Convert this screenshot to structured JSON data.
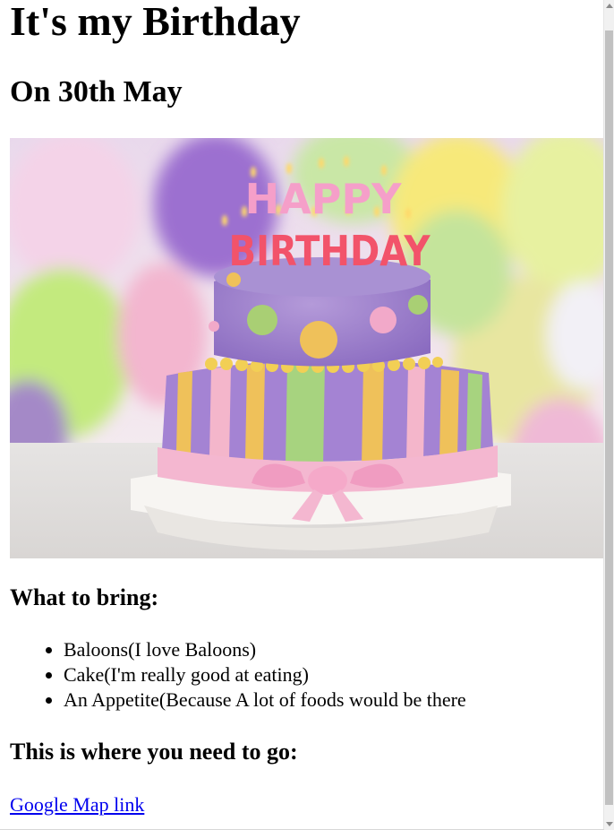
{
  "header": {
    "title": "It's my Birthday",
    "date": "On 30th May"
  },
  "image": {
    "alt": "Birthday cake with HAPPY BIRTHDAY candles",
    "candle_text_top": "HAPPY",
    "candle_text_bottom": "BIRTHDAY"
  },
  "bring": {
    "heading": "What to bring:",
    "items": [
      "Baloons(I love Baloons)",
      "Cake(I'm really good at eating)",
      "An Appetite(Because A lot of foods would be there"
    ]
  },
  "directions": {
    "heading": "This is where you need to go:",
    "link_text": "Google Map link"
  }
}
